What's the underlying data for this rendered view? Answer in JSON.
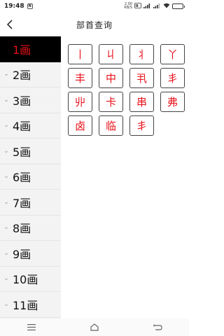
{
  "status_bar": {
    "time": "19:48",
    "notif_badge": "N",
    "net_speed_value": "2.00",
    "net_speed_unit": "KB/S",
    "battery_level": 0.8
  },
  "header": {
    "title": "部首查询"
  },
  "sidebar": {
    "items": [
      {
        "label": "1画",
        "active": true
      },
      {
        "label": "2画",
        "active": false
      },
      {
        "label": "3画",
        "active": false
      },
      {
        "label": "4画",
        "active": false
      },
      {
        "label": "5画",
        "active": false
      },
      {
        "label": "6画",
        "active": false
      },
      {
        "label": "7画",
        "active": false
      },
      {
        "label": "8画",
        "active": false
      },
      {
        "label": "9画",
        "active": false
      },
      {
        "label": "10画",
        "active": false
      },
      {
        "label": "11画",
        "active": false
      }
    ]
  },
  "radicals": [
    "丨",
    "丩",
    "丬",
    "丫",
    "丰",
    "中",
    "丮",
    "丯",
    "丱",
    "卡",
    "串",
    "弗",
    "卤",
    "临",
    "丯"
  ],
  "colors": {
    "accent_red": "#e8111a",
    "active_bg": "#000000",
    "sidebar_bg": "#f3f3f3"
  }
}
